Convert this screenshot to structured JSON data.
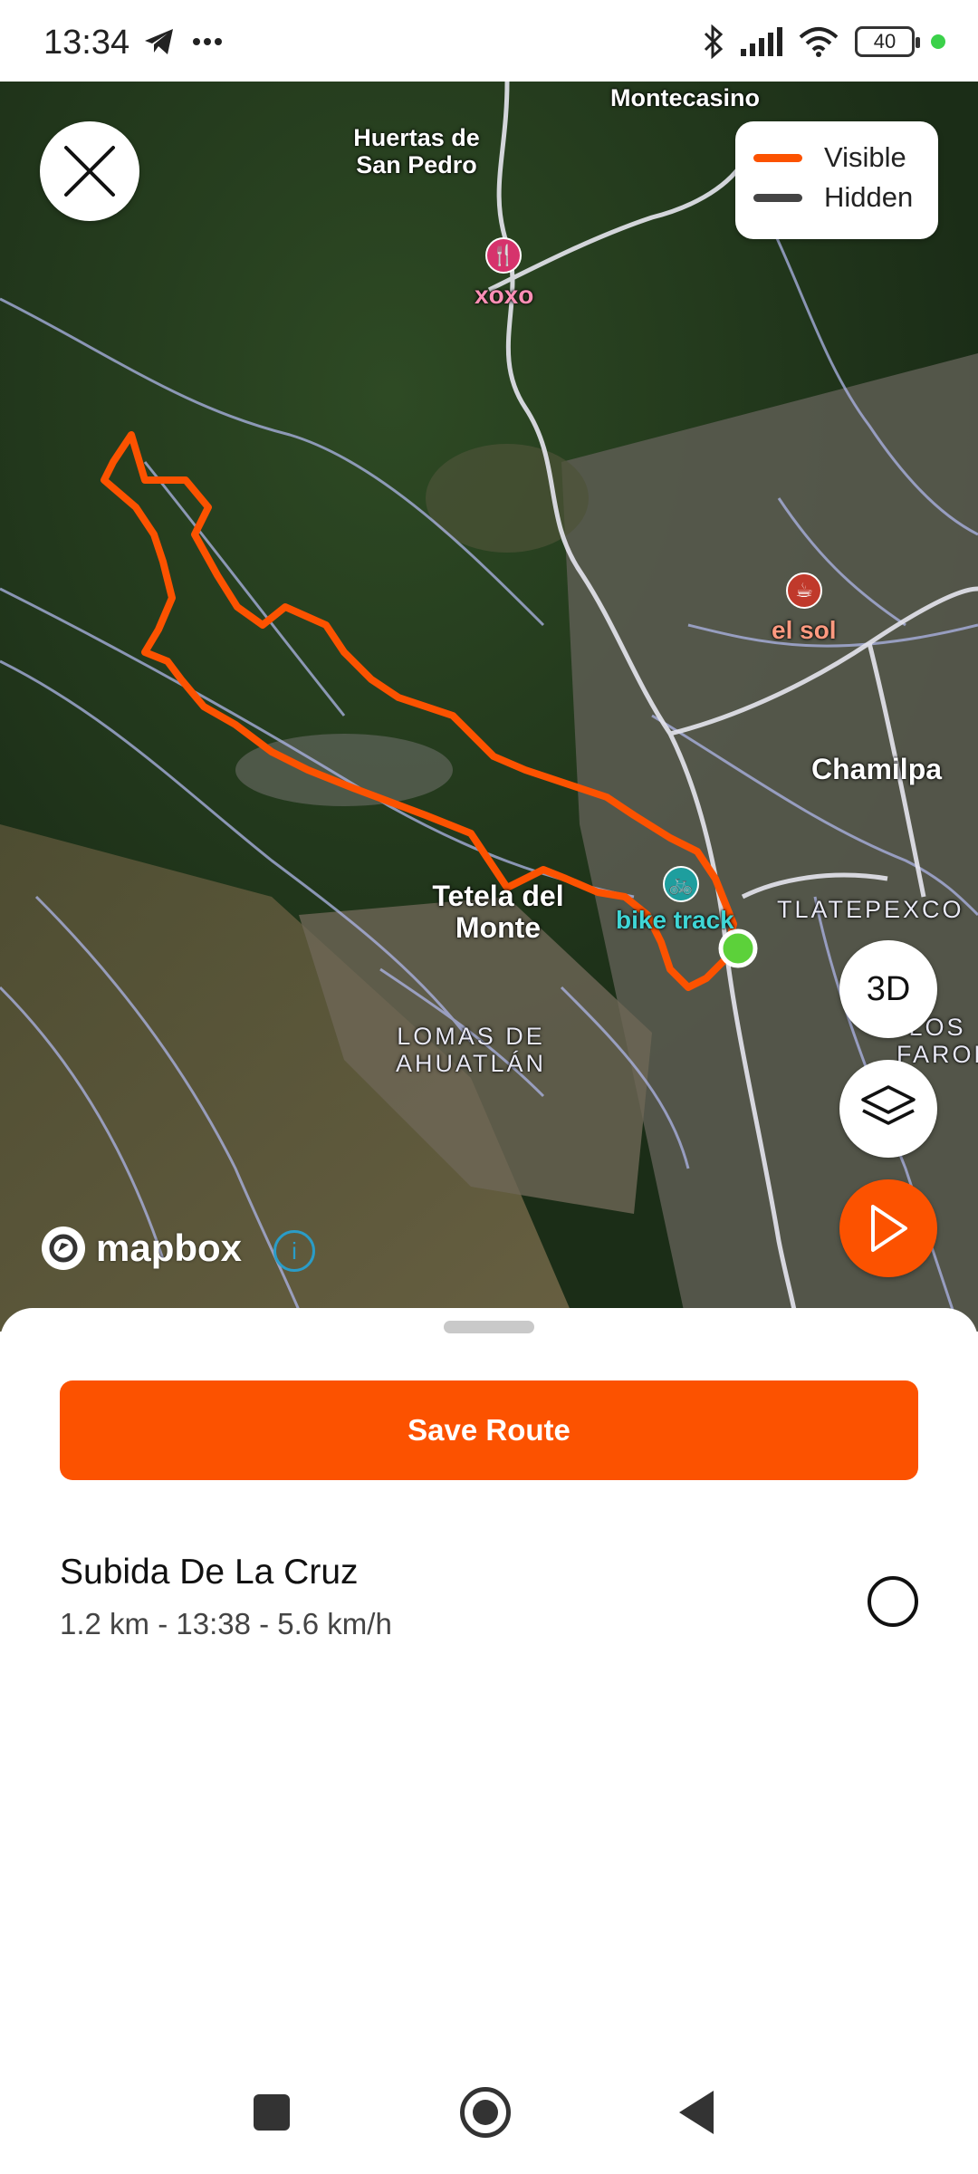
{
  "status_bar": {
    "time": "13:34",
    "telegram_icon": "telegram-icon",
    "more_icon": "more-dots-icon",
    "battery_level": "40",
    "icons": [
      "bluetooth-icon",
      "signal-icon",
      "wifi-icon",
      "battery-icon"
    ]
  },
  "map": {
    "legend": {
      "visible_label": "Visible",
      "visible_color": "#fc5200",
      "hidden_label": "Hidden",
      "hidden_color": "#444444"
    },
    "place_labels": {
      "montecasino": "Montecasino",
      "huertas_line1": "Huertas de",
      "huertas_line2": "San Pedro",
      "chamilpa": "Chamilpa",
      "tetela_line1": "Tetela del",
      "tetela_line2": "Monte",
      "tlatepexco": "TLATEPEXCO",
      "lomas_line1": "LOMAS DE",
      "lomas_line2": "AHUATLÁN",
      "faroles_line1": "LOS",
      "faroles_line2": "FAROLES"
    },
    "pois": {
      "xoxo": "xoxo",
      "el_sol": "el sol",
      "bike_track": "bike track"
    },
    "buttons": {
      "three_d": "3D"
    },
    "attribution": {
      "mapbox": "mapbox",
      "info": "i"
    },
    "route_color": "#fc5200",
    "location_dot_color": "#5cd13a"
  },
  "sheet": {
    "save_button_label": "Save Route",
    "route": {
      "name": "Subida De La Cruz",
      "meta": "1.2 km - 13:38 - 5.6 km/h"
    }
  }
}
